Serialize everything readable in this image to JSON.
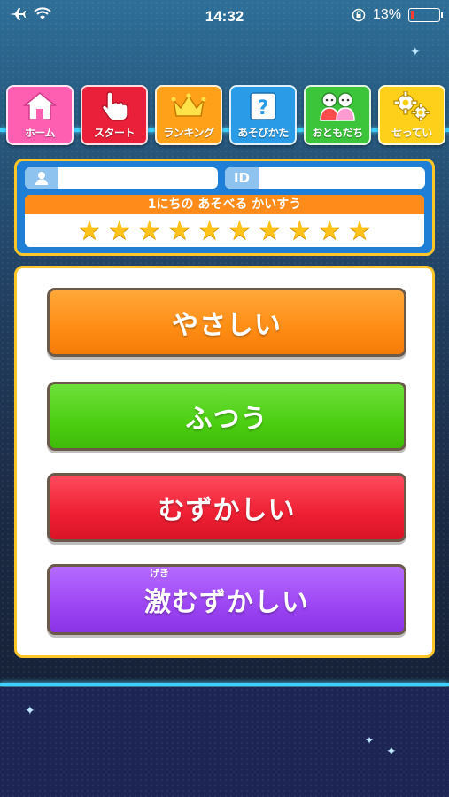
{
  "status_bar": {
    "time": "14:32",
    "battery_percent_label": "13%",
    "battery_level": 0.13
  },
  "nav": [
    {
      "label": "ホーム",
      "color": "#ff5fb0",
      "icon": "house-icon"
    },
    {
      "label": "スタート",
      "color": "#ea1f3a",
      "icon": "pointing-hand-icon"
    },
    {
      "label": "ランキング",
      "color": "#ffa21a",
      "icon": "crown-icon"
    },
    {
      "label": "あそびかた",
      "color": "#2a9be6",
      "icon": "question-icon"
    },
    {
      "label": "おともだち",
      "color": "#3cc43a",
      "icon": "friends-icon"
    },
    {
      "label": "せってい",
      "color": "#ffd01a",
      "icon": "gears-icon"
    }
  ],
  "profile": {
    "name_value": "",
    "id_label": "ID",
    "id_value": "",
    "plays_header": "1にちの あそべる かいすう",
    "plays_remaining": 10
  },
  "difficulty": {
    "easy": "やさしい",
    "normal": "ふつう",
    "hard": "むずかしい",
    "extreme_kanji": "激",
    "extreme_ruby": "げき",
    "extreme_rest": "むずかしい"
  },
  "colors": {
    "panel_border": "#ffc629",
    "accent_line": "#3fd0ff"
  }
}
